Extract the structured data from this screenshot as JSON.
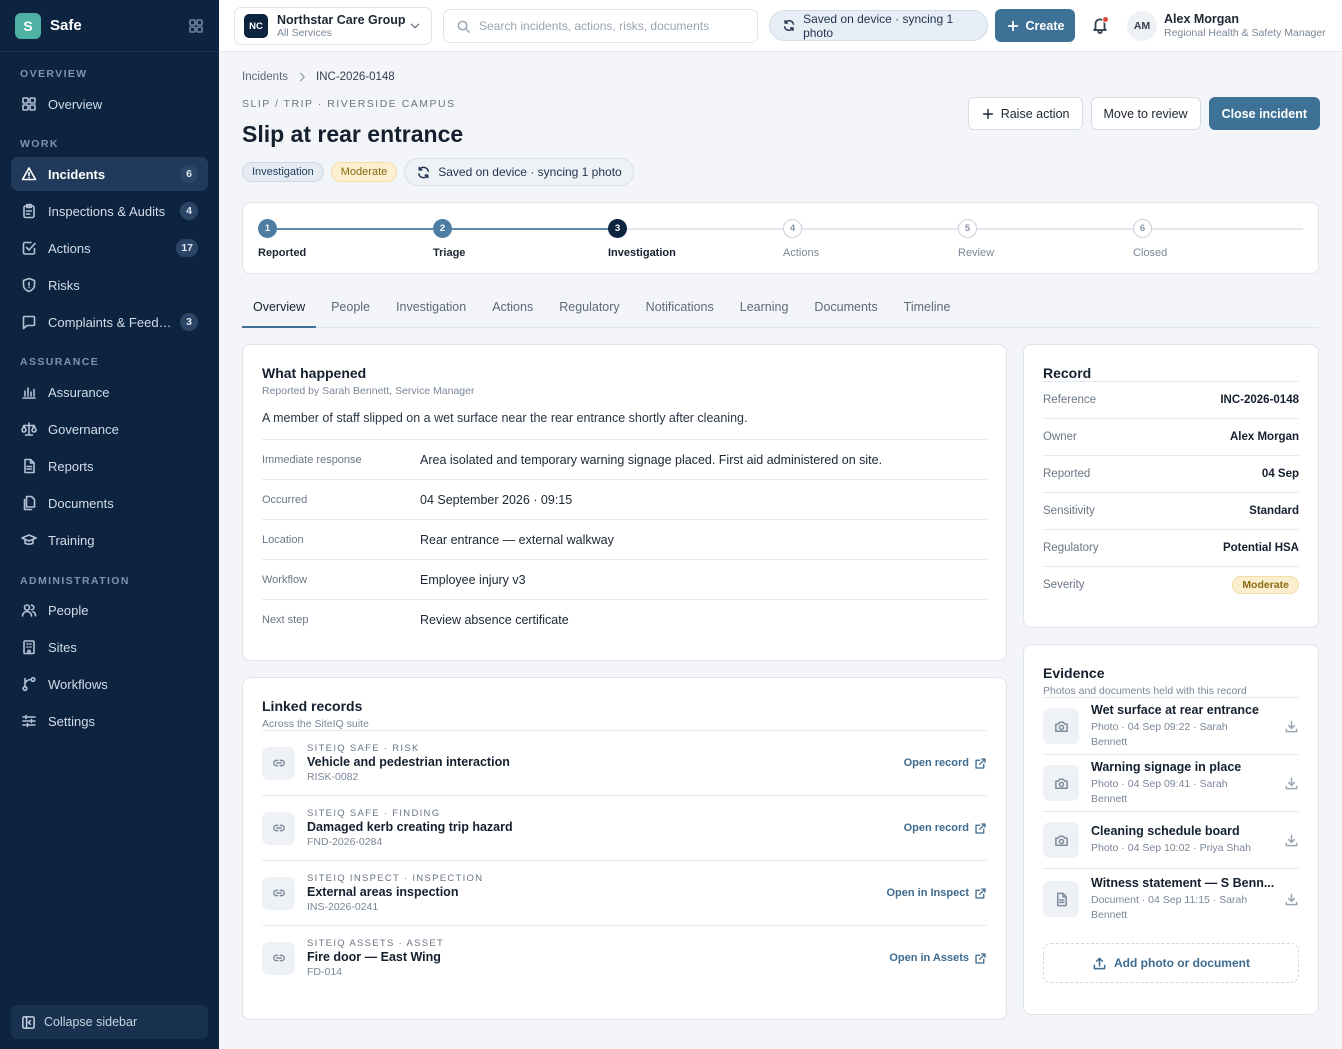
{
  "app": {
    "name": "Safe",
    "logo_letter": "S"
  },
  "sidebar": {
    "sections": [
      {
        "label": "Overview"
      },
      {
        "label": "Work"
      },
      {
        "label": "Assurance"
      },
      {
        "label": "Administration"
      }
    ],
    "items": [
      {
        "label": "Overview",
        "icon": "grid-icon"
      },
      {
        "label": "Incidents",
        "icon": "warning-icon",
        "count": "6",
        "active": true
      },
      {
        "label": "Inspections & Audits",
        "icon": "clipboard-icon",
        "count": "4"
      },
      {
        "label": "Actions",
        "icon": "checkbox-icon",
        "count": "17"
      },
      {
        "label": "Risks",
        "icon": "shield-icon"
      },
      {
        "label": "Complaints & Feed…",
        "icon": "chat-icon",
        "count": "3"
      },
      {
        "label": "Assurance",
        "icon": "bar-chart-icon"
      },
      {
        "label": "Governance",
        "icon": "scales-icon"
      },
      {
        "label": "Reports",
        "icon": "report-icon"
      },
      {
        "label": "Documents",
        "icon": "documents-icon"
      },
      {
        "label": "Training",
        "icon": "graduation-cap-icon"
      },
      {
        "label": "People",
        "icon": "people-icon"
      },
      {
        "label": "Sites",
        "icon": "building-icon"
      },
      {
        "label": "Workflows",
        "icon": "workflow-icon"
      },
      {
        "label": "Settings",
        "icon": "sliders-icon"
      }
    ],
    "collapse_label": "Collapse sidebar"
  },
  "topbar": {
    "org_initials": "NC",
    "org_name": "Northstar Care Group",
    "org_scope": "All Services",
    "search_placeholder": "Search incidents, actions, risks, documents",
    "sync_status": "Saved on device · syncing 1 photo",
    "create_label": "Create",
    "user_initials": "AM",
    "user_name": "Alex Morgan",
    "user_role": "Regional Health & Safety Manager"
  },
  "breadcrumb": {
    "parent": "Incidents",
    "current": "INC-2026-0148"
  },
  "incident": {
    "eyebrow": "Slip / Trip · Riverside Campus",
    "title": "Slip at rear entrance",
    "status_badge": "Investigation",
    "severity_badge": "Moderate",
    "sync_status": "Saved on device · syncing 1 photo"
  },
  "header_actions": {
    "raise_action": "Raise action",
    "move_to_review": "Move to review",
    "close_incident": "Close incident"
  },
  "stepper": [
    {
      "num": "1",
      "label": "Reported",
      "state": "done"
    },
    {
      "num": "2",
      "label": "Triage",
      "state": "done"
    },
    {
      "num": "3",
      "label": "Investigation",
      "state": "current"
    },
    {
      "num": "4",
      "label": "Actions",
      "state": "todo"
    },
    {
      "num": "5",
      "label": "Review",
      "state": "todo"
    },
    {
      "num": "6",
      "label": "Closed",
      "state": "todo"
    }
  ],
  "tabs": [
    "Overview",
    "People",
    "Investigation",
    "Actions",
    "Regulatory",
    "Notifications",
    "Learning",
    "Documents",
    "Timeline"
  ],
  "what_happened": {
    "title": "What happened",
    "subtitle": "Reported by Sarah Bennett, Service Manager",
    "description": "A member of staff slipped on a wet surface near the rear entrance shortly after cleaning.",
    "fields": [
      {
        "label": "Immediate response",
        "value": "Area isolated and temporary warning signage placed. First aid administered on site."
      },
      {
        "label": "Occurred",
        "value": "04 September 2026 · 09:15"
      },
      {
        "label": "Location",
        "value": "Rear entrance — external walkway"
      },
      {
        "label": "Workflow",
        "value": "Employee injury v3"
      },
      {
        "label": "Next step",
        "value": "Review absence certificate"
      }
    ]
  },
  "linked_records": {
    "title": "Linked records",
    "subtitle": "Across the SiteIQ suite",
    "items": [
      {
        "eyebrow": "SiteIQ Safe · Risk",
        "name": "Vehicle and pedestrian interaction",
        "ref": "RISK-0082",
        "open_label": "Open record"
      },
      {
        "eyebrow": "SiteIQ Safe · Finding",
        "name": "Damaged kerb creating trip hazard",
        "ref": "FND-2026-0284",
        "open_label": "Open record"
      },
      {
        "eyebrow": "SiteIQ Inspect · Inspection",
        "name": "External areas inspection",
        "ref": "INS-2026-0241",
        "open_label": "Open in Inspect"
      },
      {
        "eyebrow": "SiteIQ Assets · Asset",
        "name": "Fire door — East Wing",
        "ref": "FD-014",
        "open_label": "Open in Assets"
      }
    ]
  },
  "record": {
    "title": "Record",
    "rows": [
      {
        "label": "Reference",
        "value": "INC-2026-0148"
      },
      {
        "label": "Owner",
        "value": "Alex Morgan"
      },
      {
        "label": "Reported",
        "value": "04 Sep"
      },
      {
        "label": "Sensitivity",
        "value": "Standard"
      },
      {
        "label": "Regulatory",
        "value": "Potential HSA"
      },
      {
        "label": "Severity",
        "value": "Moderate"
      }
    ]
  },
  "evidence": {
    "title": "Evidence",
    "subtitle": "Photos and documents held with this record",
    "items": [
      {
        "name": "Wet surface at rear entrance",
        "meta": "Photo · 04 Sep 09:22 · Sarah Bennett",
        "icon": "camera-icon"
      },
      {
        "name": "Warning signage in place",
        "meta": "Photo · 04 Sep 09:41 · Sarah Bennett",
        "icon": "camera-icon"
      },
      {
        "name": "Cleaning schedule board",
        "meta": "Photo · 04 Sep 10:02 · Priya Shah",
        "icon": "camera-icon"
      },
      {
        "name": "Witness statement — S Benn...",
        "meta": "Document · 04 Sep 11:15 · Sarah Bennett",
        "icon": "document-icon"
      }
    ],
    "add_label": "Add photo or document"
  },
  "colors": {
    "sidebar_bg": "#0d2441",
    "accent": "#3e7196",
    "brand": "#4fb1a3",
    "moderate_bg": "#fbefcf"
  }
}
